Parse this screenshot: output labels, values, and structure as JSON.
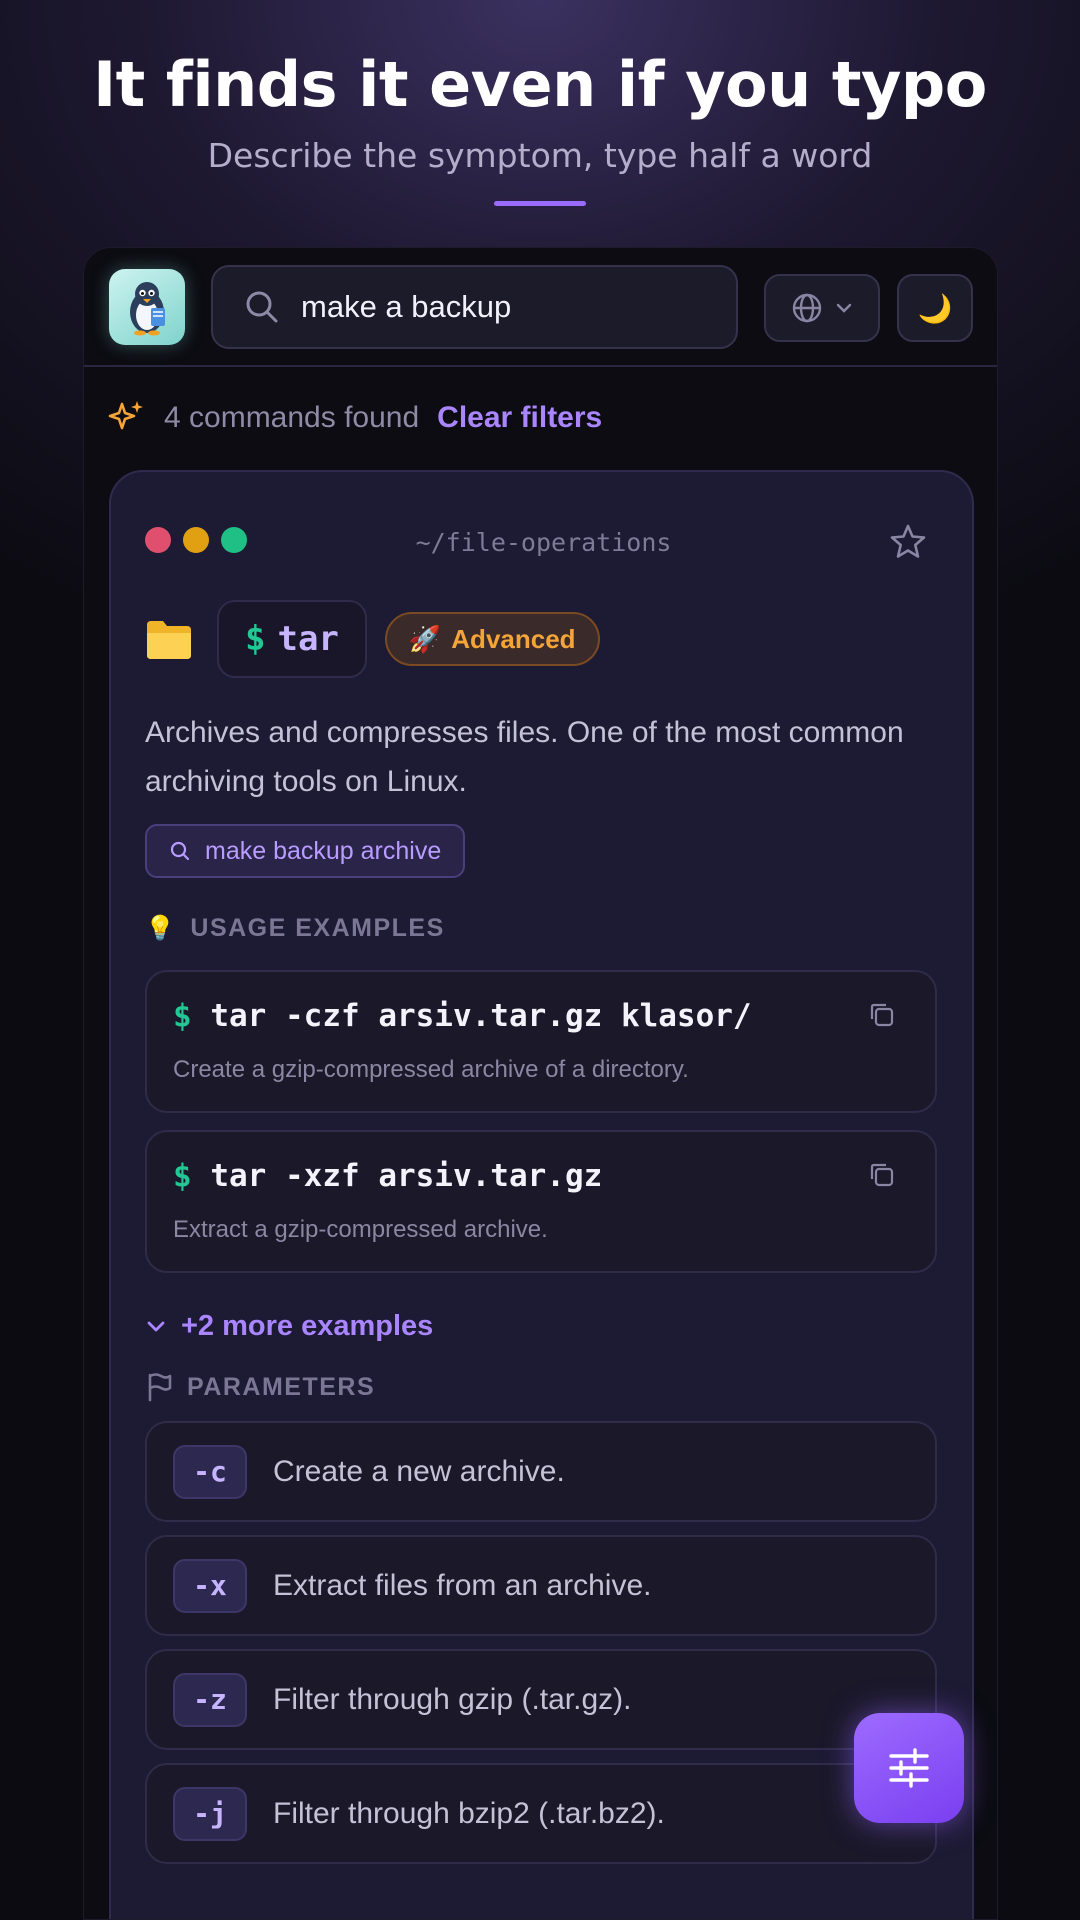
{
  "hero": {
    "title": "It finds it even if you typo",
    "subtitle": "Describe the symptom, type half a word"
  },
  "topbar": {
    "search_value": "make a backup",
    "logo_icon": "penguin-logo-icon",
    "language_icon": "globe-icon",
    "theme_icon": "moon-icon",
    "theme_glyph": "🌙"
  },
  "results": {
    "count_text": "4 commands found",
    "clear_label": "Clear filters"
  },
  "card": {
    "path": "~/file-operations",
    "dot_colors": [
      "#e0506e",
      "#e0a012",
      "#1fbf85"
    ],
    "command_prompt": "$",
    "command_name": "tar",
    "level_emoji": "🚀",
    "level_label": "Advanced",
    "description": "Archives and compresses files. One of the most common archiving tools on Linux.",
    "keyword": "make backup archive",
    "usage_header_emoji": "💡",
    "usage_header": "USAGE EXAMPLES",
    "examples": [
      {
        "prompt": "$",
        "command": "tar -czf arsiv.tar.gz klasor/",
        "description": "Create a gzip-compressed archive of a directory."
      },
      {
        "prompt": "$",
        "command": "tar -xzf arsiv.tar.gz",
        "description": "Extract a gzip-compressed archive."
      }
    ],
    "more_examples": "+2 more examples",
    "params_header": "PARAMETERS",
    "parameters": [
      {
        "flag": "-c",
        "description": "Create a new archive."
      },
      {
        "flag": "-x",
        "description": "Extract files from an archive."
      },
      {
        "flag": "-z",
        "description": "Filter through gzip (.tar.gz)."
      },
      {
        "flag": "-j",
        "description": "Filter through bzip2 (.tar.bz2)."
      }
    ]
  },
  "fab": {
    "icon": "sliders-icon"
  },
  "colors": {
    "accent": "#a985ff",
    "prompt_green": "#22c793",
    "badge_orange": "#f5a43a"
  }
}
